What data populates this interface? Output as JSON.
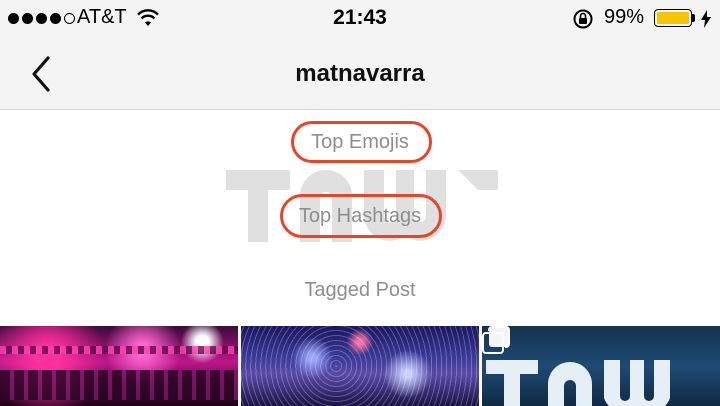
{
  "status_bar": {
    "carrier": "AT&T",
    "time": "21:43",
    "battery_percent": "99%",
    "battery_level": 0.99,
    "signal_bars_filled": 4,
    "signal_bars_total": 5
  },
  "nav": {
    "back_icon": "chevron-left-icon",
    "title": "matnavarra"
  },
  "sections": {
    "top_emojis": "Top Emojis",
    "top_hashtags": "Top Hashtags",
    "tagged_post": "Tagged Post"
  },
  "watermark_text": "TNW",
  "photo_grid": {
    "tiles": [
      {
        "desc_icon": "photo-thumbnail"
      },
      {
        "desc_icon": "photo-thumbnail"
      },
      {
        "desc_icon": "photo-thumbnail",
        "badge_icon": "multiple-posts-icon"
      }
    ]
  },
  "colors": {
    "highlight": "#e84528",
    "battery": "#f5c400",
    "section_text": "#8e8e8e"
  }
}
